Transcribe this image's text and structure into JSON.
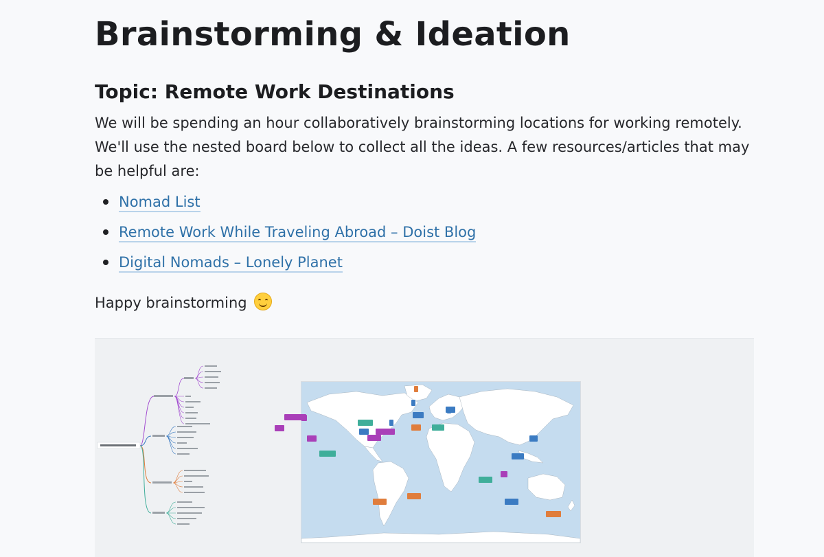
{
  "page": {
    "title": "Brainstorming & Ideation",
    "topic": "Topic: Remote Work Destinations",
    "intro": "We will be spending an hour collaboratively brainstorming locations for working remotely. We'll use the nested board below to collect all the ideas. A few resources/articles that may be helpful are:",
    "links": [
      {
        "label": "Nomad List"
      },
      {
        "label": "Remote Work While Traveling Abroad – Doist Blog"
      },
      {
        "label": "Digital Nomads – Lonely Planet"
      }
    ],
    "closing": "Happy brainstorming",
    "closing_icon": "smiling-face-icon"
  },
  "board": {
    "mindmap": {
      "root": "Remote Work Destinations",
      "branches": [
        {
          "label": "Warm & Beachy",
          "color": "#a24bd0"
        },
        {
          "label": "Urban",
          "color": "#3b7bc2"
        },
        {
          "label": "Adventurous",
          "color": "#e07d3c"
        },
        {
          "label": "Unique",
          "color": "#3fae9a"
        }
      ]
    },
    "map_tags": [
      {
        "color": "#e07d3c"
      },
      {
        "color": "#3b7bc2"
      },
      {
        "color": "#3b7bc2"
      },
      {
        "color": "#a93fb8"
      },
      {
        "color": "#3fae9a"
      },
      {
        "color": "#3b7bc2"
      },
      {
        "color": "#3fae9a"
      },
      {
        "color": "#3b7bc2"
      },
      {
        "color": "#a93fb8"
      },
      {
        "color": "#a93fb8"
      },
      {
        "color": "#3b7bc2"
      },
      {
        "color": "#a93fb8"
      },
      {
        "color": "#a93fb8"
      },
      {
        "color": "#e07d3c"
      },
      {
        "color": "#3fae9a"
      },
      {
        "color": "#3b7bc2"
      },
      {
        "color": "#3fae9a"
      },
      {
        "color": "#3fae9a"
      },
      {
        "color": "#3b7bc2"
      },
      {
        "color": "#a93fb8"
      },
      {
        "color": "#e07d3c"
      },
      {
        "color": "#e07d3c"
      },
      {
        "color": "#3b7bc2"
      },
      {
        "color": "#e07d3c"
      }
    ]
  }
}
